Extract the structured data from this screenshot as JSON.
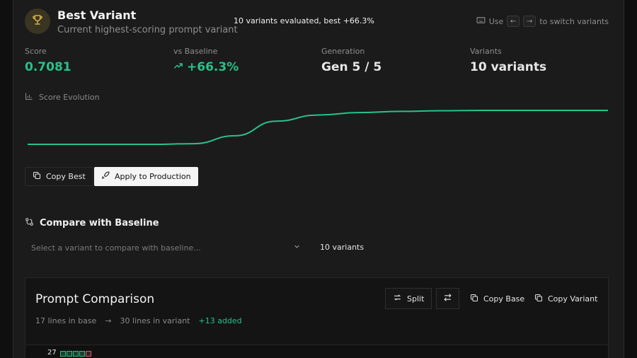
{
  "header": {
    "title": "Best Variant",
    "subtitle": "Current highest-scoring prompt variant",
    "summary": "10 variants evaluated, best +66.3%",
    "hint": {
      "use": "Use",
      "key_left": "←",
      "key_right": "→",
      "suffix": "to switch variants"
    }
  },
  "stats": [
    {
      "label": "Score",
      "value": "0.7081"
    },
    {
      "label": "vs Baseline",
      "value": "+66.3%"
    },
    {
      "label": "Generation",
      "value": "Gen 5 / 5"
    },
    {
      "label": "Variants",
      "value": "10 variants"
    }
  ],
  "chart_data": {
    "type": "line",
    "title": "Score Evolution",
    "xlabel": "",
    "ylabel": "",
    "grid": false,
    "values": [
      0.43,
      0.43,
      0.43,
      0.43,
      0.435,
      0.5,
      0.62,
      0.67,
      0.69,
      0.7,
      0.705,
      0.708,
      0.7081,
      0.7081,
      0.7081
    ],
    "color": "#26c28a"
  },
  "actions": {
    "copy_best": "Copy Best",
    "apply": "Apply to Production"
  },
  "compare": {
    "title": "Compare with Baseline",
    "select_placeholder": "Select a variant to compare with baseline...",
    "variant_count": "10 variants"
  },
  "prompt_comparison": {
    "title": "Prompt Comparison",
    "base_lines": "17 lines in base",
    "arrow": "→",
    "variant_lines": "30 lines in variant",
    "added": "+13 added",
    "split_label": "Split",
    "copy_base": "Copy Base",
    "copy_variant": "Copy Variant",
    "line_number": "27"
  },
  "colors": {
    "accent": "#26c28a",
    "background": "#1b1b1b",
    "gold": "#d8b04a"
  }
}
